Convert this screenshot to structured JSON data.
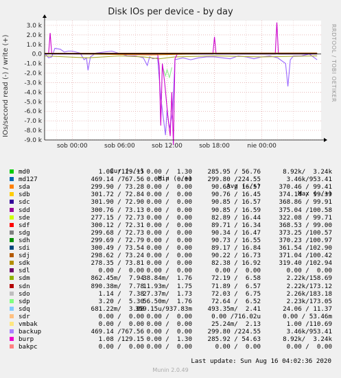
{
  "chart_data": {
    "type": "line",
    "title": "Disk IOs per device - by day",
    "ylabel": "IOs/second read (-) / write (+)",
    "ylim": [
      -9000,
      3500
    ],
    "yticks": [
      {
        "value": 3000,
        "label": "3.0 k"
      },
      {
        "value": 2000,
        "label": "2.0 k"
      },
      {
        "value": 1000,
        "label": "1.0 k"
      },
      {
        "value": 0,
        "label": "0.0"
      },
      {
        "value": -1000,
        "label": "-1.0 k"
      },
      {
        "value": -2000,
        "label": "-2.0 k"
      },
      {
        "value": -3000,
        "label": "-3.0 k"
      },
      {
        "value": -4000,
        "label": "-4.0 k"
      },
      {
        "value": -5000,
        "label": "-5.0 k"
      },
      {
        "value": -6000,
        "label": "-6.0 k"
      },
      {
        "value": -7000,
        "label": "-7.0 k"
      },
      {
        "value": -8000,
        "label": "-8.0 k"
      },
      {
        "value": -9000,
        "label": "-9.0 k"
      }
    ],
    "xrange_hours": [
      -3.5,
      31.5
    ],
    "xticks": [
      {
        "hour": 0,
        "label": "sob 00:00"
      },
      {
        "hour": 6,
        "label": "sob 06:00"
      },
      {
        "hour": 12,
        "label": "sob 12:00"
      },
      {
        "hour": 18,
        "label": "sob 18:00"
      },
      {
        "hour": 24,
        "label": "nie 00:00"
      }
    ],
    "grid": true,
    "series": [
      {
        "name": "backup",
        "color": "#9966ff",
        "points": [
          [
            -3.5,
            0.1
          ],
          [
            -3,
            -0.4
          ],
          [
            -2.6,
            -0.3
          ],
          [
            -2.2,
            0.6
          ],
          [
            -1.5,
            0.5
          ],
          [
            -1,
            0.2
          ],
          [
            -0.5,
            0.3
          ],
          [
            0,
            0.3
          ],
          [
            1,
            0.1
          ],
          [
            1.5,
            -0.6
          ],
          [
            1.8,
            -0.4
          ],
          [
            2.0,
            -1.7
          ],
          [
            2.3,
            -0.3
          ],
          [
            3,
            0.1
          ],
          [
            5,
            0.3
          ],
          [
            7,
            -0.2
          ],
          [
            8,
            -0.2
          ],
          [
            9,
            -0.4
          ],
          [
            9.5,
            -1.2
          ],
          [
            9.8,
            -0.3
          ],
          [
            10.2,
            -0.5
          ],
          [
            10.8,
            -0.4
          ],
          [
            11.2,
            -4.5
          ],
          [
            11.5,
            -6.5
          ],
          [
            11.8,
            -8.5
          ],
          [
            12.0,
            -5.8
          ],
          [
            12.3,
            -7.8
          ],
          [
            12.7,
            -6.2
          ],
          [
            13,
            -0.6
          ],
          [
            14,
            -0.4
          ],
          [
            15,
            -0.6
          ],
          [
            16,
            -0.4
          ],
          [
            17,
            -0.3
          ],
          [
            18,
            -0.3
          ],
          [
            19,
            -0.4
          ],
          [
            20,
            -0.5
          ],
          [
            21,
            -0.2
          ],
          [
            22,
            -0.3
          ],
          [
            23,
            -0.5
          ],
          [
            24,
            -0.3
          ],
          [
            25,
            -0.2
          ],
          [
            26,
            -0.4
          ],
          [
            27,
            -1.0
          ],
          [
            27.3,
            -3.4
          ],
          [
            27.6,
            -0.6
          ],
          [
            28,
            -0.2
          ],
          [
            29,
            -0.2
          ],
          [
            30,
            0.0
          ],
          [
            31,
            -0.6
          ]
        ]
      },
      {
        "name": "sdm",
        "color": "#a9a929",
        "points": [
          [
            -3.5,
            -0.2
          ],
          [
            2,
            -0.4
          ],
          [
            6,
            -0.2
          ],
          [
            9,
            -0.3
          ],
          [
            11,
            -0.5
          ],
          [
            13,
            -0.3
          ],
          [
            18,
            -0.2
          ],
          [
            24,
            -0.3
          ],
          [
            31,
            -0.2
          ]
        ]
      },
      {
        "name": "sdp",
        "color": "#90ee90",
        "points": [
          [
            11.5,
            -1.5
          ],
          [
            11.8,
            -2.3
          ],
          [
            12.0,
            -1.6
          ],
          [
            12.3,
            -2.5
          ],
          [
            12.6,
            -1.4
          ]
        ]
      },
      {
        "name": "burp",
        "color": "#cc00cc",
        "points": [
          [
            -3.5,
            0
          ],
          [
            -3.0,
            0
          ],
          [
            -2.8,
            2.2
          ],
          [
            -2.6,
            0
          ],
          [
            9,
            0
          ],
          [
            10.8,
            0
          ],
          [
            11.0,
            -1.2
          ],
          [
            11.2,
            -7.5
          ],
          [
            11.4,
            -1.0
          ],
          [
            11.7,
            -3.0
          ],
          [
            12.1,
            -6.5
          ],
          [
            12.4,
            -8.6
          ],
          [
            12.6,
            -4.0
          ],
          [
            12.8,
            -9.5
          ],
          [
            13.0,
            -0.5
          ],
          [
            13.3,
            0
          ],
          [
            17.8,
            0
          ],
          [
            18.0,
            1.8
          ],
          [
            18.2,
            0
          ],
          [
            19,
            0
          ],
          [
            24,
            0
          ],
          [
            25.7,
            0
          ],
          [
            25.9,
            3.3
          ],
          [
            26.1,
            0
          ],
          [
            31,
            0
          ]
        ]
      },
      {
        "name": "sdq",
        "color": "#8a2be2",
        "points": [
          [
            -3.5,
            0.05
          ],
          [
            31,
            0.05
          ]
        ]
      },
      {
        "name": "sdr",
        "color": "#ff8000",
        "points": [
          [
            -3.5,
            0.05
          ],
          [
            10,
            -0.1
          ],
          [
            20,
            0.08
          ],
          [
            31,
            0.1
          ]
        ]
      },
      {
        "name": "md0",
        "color": "#8b4513",
        "points": [
          [
            -3.5,
            0.08
          ],
          [
            31,
            0.1
          ]
        ]
      },
      {
        "name": "sdb",
        "color": "#000000",
        "points": [
          [
            -3.5,
            0.02
          ],
          [
            31,
            0.02
          ]
        ]
      }
    ],
    "legend": {
      "headers": [
        "Cur (-/+)",
        "Min (-/+)",
        "Avg (-/+)",
        "Max (-/+)"
      ],
      "rows": [
        {
          "name": "md0",
          "color": "#00cc00",
          "cur": "1.08 /129.15",
          "min": "0.00 /  1.30",
          "avg": "285.95 / 56.76",
          "max": "8.92k/  3.24k"
        },
        {
          "name": "md127",
          "color": "#0066b3",
          "cur": "469.14 /767.56",
          "min": "0.00 /  0.00",
          "avg": "299.80 /224.55",
          "max": "3.46k/953.41"
        },
        {
          "name": "sda",
          "color": "#ff8000",
          "cur": "299.90 / 73.28",
          "min": "0.00 /  0.00",
          "avg": "90.63 / 16.57",
          "max": "370.46 / 99.41"
        },
        {
          "name": "sdb",
          "color": "#ffcc00",
          "cur": "301.72 / 72.84",
          "min": "0.00 /  0.00",
          "avg": "90.76 / 16.45",
          "max": "374.14 / 99.39"
        },
        {
          "name": "sdc",
          "color": "#330099",
          "cur": "301.90 / 72.90",
          "min": "0.00 /  0.00",
          "avg": "90.85 / 16.57",
          "max": "368.86 / 99.91"
        },
        {
          "name": "sdd",
          "color": "#990099",
          "cur": "300.76 / 73.13",
          "min": "0.00 /  0.00",
          "avg": "90.85 / 16.59",
          "max": "375.04 /100.58"
        },
        {
          "name": "sde",
          "color": "#ccff00",
          "cur": "277.15 / 72.73",
          "min": "0.00 /  0.00",
          "avg": "82.89 / 16.44",
          "max": "322.08 / 99.71"
        },
        {
          "name": "sdf",
          "color": "#ff0000",
          "cur": "300.12 / 72.31",
          "min": "0.00 /  0.00",
          "avg": "89.71 / 16.34",
          "max": "368.53 / 99.00"
        },
        {
          "name": "sdg",
          "color": "#808080",
          "cur": "299.68 / 72.73",
          "min": "0.00 /  0.00",
          "avg": "90.34 / 16.47",
          "max": "373.25 /100.57"
        },
        {
          "name": "sdh",
          "color": "#008f00",
          "cur": "299.69 / 72.79",
          "min": "0.00 /  0.00",
          "avg": "90.73 / 16.55",
          "max": "370.23 /100.97"
        },
        {
          "name": "sdi",
          "color": "#00487d",
          "cur": "300.49 / 73.54",
          "min": "0.00 /  0.00",
          "avg": "89.17 / 16.84",
          "max": "361.54 /102.90"
        },
        {
          "name": "sdj",
          "color": "#b35a00",
          "cur": "298.62 / 73.24",
          "min": "0.00 /  0.00",
          "avg": "90.22 / 16.73",
          "max": "371.04 /100.42"
        },
        {
          "name": "sdk",
          "color": "#b38f00",
          "cur": "278.35 / 73.81",
          "min": "0.00 /  0.00",
          "avg": "82.38 / 16.92",
          "max": "319.40 /102.94"
        },
        {
          "name": "sdl",
          "color": "#6b006b",
          "cur": "0.00 /  0.00",
          "min": "0.00 /  0.00",
          "avg": "0.00 /  0.00",
          "max": "0.00 /  0.00"
        },
        {
          "name": "sdm",
          "color": "#8fb300",
          "cur": "862.45m/  7.94",
          "min": "38.84m/  1.76",
          "avg": "72.19 /  6.58",
          "max": "2.22k/158.69"
        },
        {
          "name": "sdn",
          "color": "#b30000",
          "cur": "890.38m/  7.78",
          "min": "11.93m/  1.75",
          "avg": "71.89 /  6.57",
          "max": "2.22k/173.12"
        },
        {
          "name": "sdo",
          "color": "#bebebe",
          "cur": "1.14 /  7.38",
          "min": "27.37m/  1.73",
          "avg": "72.03 /  6.75",
          "max": "2.26k/183.18"
        },
        {
          "name": "sdp",
          "color": "#80ff80",
          "cur": "3.20 /  5.30",
          "min": "56.50m/  1.76",
          "avg": "72.64 /  6.52",
          "max": "2.23k/173.05"
        },
        {
          "name": "sdq",
          "color": "#80c9ff",
          "cur": "681.22m/  3.08",
          "min": "359.15u/937.83m",
          "avg": "493.35m/  2.41",
          "max": "24.06 / 11.37"
        },
        {
          "name": "sdr",
          "color": "#ffc080",
          "cur": "0.00 /  0.00",
          "min": "0.00 /  0.00",
          "avg": "0.00 /716.02u",
          "max": "0.00 / 53.46m"
        },
        {
          "name": "vmbak",
          "color": "#ffe680",
          "cur": "0.00 /  0.00",
          "min": "0.00 /  0.00",
          "avg": "25.24m/  2.13",
          "max": "1.00 /110.69"
        },
        {
          "name": "backup",
          "color": "#aa80ff",
          "cur": "469.14 /767.56",
          "min": "0.00 /  0.00",
          "avg": "299.80 /224.55",
          "max": "3.46k/953.41"
        },
        {
          "name": "burp",
          "color": "#ee00cc",
          "cur": "1.08 /129.15",
          "min": "0.00 /  1.30",
          "avg": "285.92 / 54.63",
          "max": "8.92k/  3.24k"
        },
        {
          "name": "bakpc",
          "color": "#ff8080",
          "cur": "0.00 /  0.00",
          "min": "0.00 /  0.00",
          "avg": "0.00 /  0.00",
          "max": "0.00 /  0.00"
        }
      ]
    }
  },
  "watermark": "RRDTOOL / TOBI OETIKER",
  "last_update": "Last update: Sun Aug 16 04:02:36 2020",
  "footer": "Munin 2.0.49"
}
